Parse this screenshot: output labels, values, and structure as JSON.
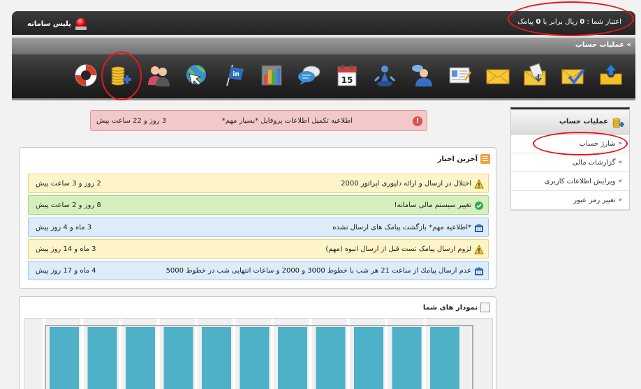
{
  "header": {
    "brand": "پلیس سامانه",
    "credit_prefix": "اعتبار شما :",
    "credit_value": "0",
    "credit_middle": "ریال برابر با",
    "credit_sms": "0",
    "credit_suffix": "پیامک"
  },
  "page_title": "» عملیات حساب",
  "toolbar_icons": [
    "inbox-upload-icon",
    "envelope-check-icon",
    "envelope-download-icon",
    "envelope-icon",
    "id-card-icon",
    "user-chat-icon",
    "chat-bubbles-icon",
    "calendar-icon",
    "chess-pawn-icon",
    "bar-chart-icon",
    "linkedin-flag-icon",
    "globe-cursor-icon",
    "users-icon",
    "coins-add-icon",
    "lifebuoy-icon"
  ],
  "calendar_day": "15",
  "alert": {
    "text": "اطلاعیه تکمیل اطلاعات پروفایل *بسیار مهم*",
    "time": "3 روز و 22 ساعت پیش"
  },
  "sidebar": {
    "title": "عملیات حساب",
    "items": [
      {
        "label": "شارژ حساب"
      },
      {
        "label": "گزارشات مالی"
      },
      {
        "label": "ویرایش اطلاعات کاربری"
      },
      {
        "label": "تغییر رمز عبور"
      }
    ]
  },
  "news": {
    "title": "آخرین اخبار",
    "items": [
      {
        "type": "warning",
        "text": "اختلال در ارسال و ارائه دلیوری اپراتور 2000",
        "time": "2 روز و 3 ساعت پیش"
      },
      {
        "type": "success",
        "text": "تغییر سیستم مالی سامانه!",
        "time": "8 روز و 2 ساعت پیش"
      },
      {
        "type": "info",
        "text": "*اطلاعیه مهم* بازگشت پیامک های ارسال نشده",
        "time": "3 ماه و 4 روز پیش"
      },
      {
        "type": "warning",
        "text": "لزوم ارسال پیامک تست قبل از ارسال انبوه (مهم)",
        "time": "3 ماه و 14 روز پیش"
      },
      {
        "type": "info",
        "text": "عدم ارسال پیامك از ساعت 21 هر شب با خطوط 3000 و 2000 و ساعات انتهایی شب در خطوط 5000",
        "time": "4 ماه و 17 روز پیش"
      }
    ]
  },
  "chart_panel": {
    "title": "نمودار های شما"
  },
  "colors": {
    "bar": "#4eb1c8",
    "highlight": "#e8171a"
  }
}
